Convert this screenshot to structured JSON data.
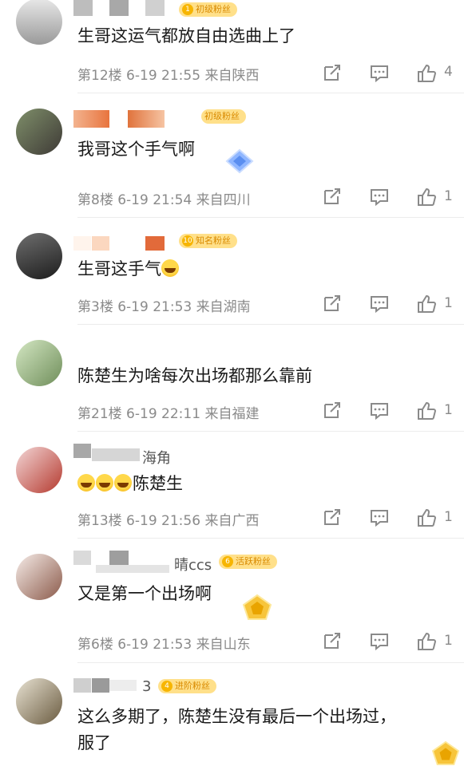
{
  "comments": [
    {
      "username": "",
      "badge_level": "1",
      "badge": "初级粉丝",
      "text": "生哥这运气都放自由选曲上了",
      "floor": "第12楼",
      "date": "6-19",
      "time": "21:55",
      "location": "来自陕西",
      "likes": "4"
    },
    {
      "username": "",
      "badge_level": "",
      "badge": "初级粉丝",
      "text": "我哥这个手气啊",
      "floor": "第8楼",
      "date": "6-19",
      "time": "21:54",
      "location": "来自四川",
      "likes": "1"
    },
    {
      "username": "",
      "badge_level": "10",
      "badge": "知名粉丝",
      "text": "生哥这手气",
      "floor": "第3楼",
      "date": "6-19",
      "time": "21:53",
      "location": "来自湖南",
      "likes": "1"
    },
    {
      "username": "",
      "badge_level": "",
      "badge": "",
      "text": "陈楚生为啥每次出场都那么靠前",
      "floor": "第21楼",
      "date": "6-19",
      "time": "22:11",
      "location": "来自福建",
      "likes": "1"
    },
    {
      "username": "海角",
      "badge_level": "",
      "badge": "",
      "text": "陈楚生",
      "floor": "第13楼",
      "date": "6-19",
      "time": "21:56",
      "location": "来自广西",
      "likes": "1"
    },
    {
      "username": "晴ccs",
      "badge_level": "6",
      "badge": "活跃粉丝",
      "text": "又是第一个出场啊",
      "floor": "第6楼",
      "date": "6-19",
      "time": "21:53",
      "location": "来自山东",
      "likes": "1"
    },
    {
      "username": "3",
      "badge_level": "4",
      "badge": "进阶粉丝",
      "text": "这么多期了，陈楚生没有最后一个出场过，\n服了",
      "floor": "",
      "date": "",
      "time": "",
      "location": "",
      "likes": ""
    }
  ],
  "icons": {
    "share": "share-icon",
    "comment": "comment-icon",
    "like": "thumbs-up-icon"
  },
  "colors": {
    "badge_bg": "#ffe08a",
    "meta_text": "#8a8a8a"
  }
}
